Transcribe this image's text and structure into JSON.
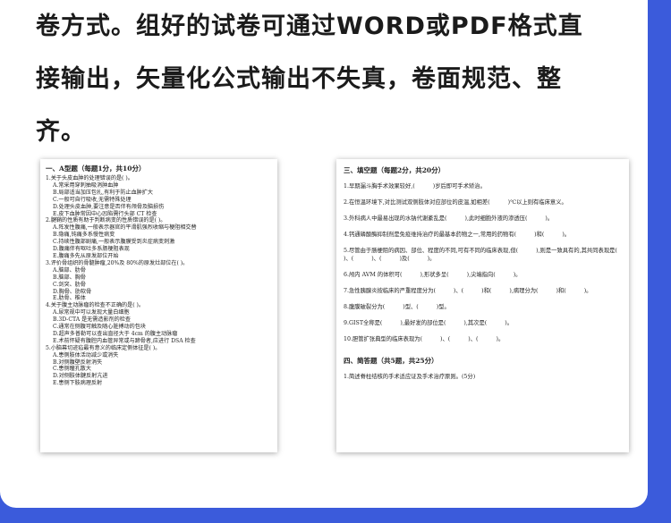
{
  "intro_lines": [
    "卷方式。组好的试卷可通过WORD或PDF格式直",
    "接输出，矢量化公式输出不失真，卷面规范、整",
    "齐。"
  ],
  "left_paper": {
    "title": "一、A型题（每题1分，共10分）",
    "questions": [
      {
        "q": "1.关于头皮血肿的处理错误的是(     )。",
        "options": [
          "A.常采用穿刺抽吸消肿血肿",
          "B.局部适当加压包扎,有利于防止血肿扩大",
          "C.一般可自行吸收,无需特殊处理",
          "D.处理头皮血肿,要注意是否伴有颅骨及脑损伤",
          "E.皮下血肿常因中心凹陷需行头部 CT 检查"
        ]
      },
      {
        "q": "2.腱鞘的性质有助于判断病变的性质错误的是(     )。",
        "options": [
          "A.阵发性腹痛,一般表示器官的平滑肌强烈收缩与梗阻相交替",
          "B.隐痛,钝痛多系慢性病变",
          "C.持续性腹部剧痛,一般表示腹膜受到炎症病变刺激",
          "D.腹痛伴有呕吐多系肠梗阻表现",
          "E.腹痛多先从原发部位开始"
        ]
      },
      {
        "q": "3.评价骨组织的骨髓肿瘤,20%及 80%的原发灶部位在(     )。",
        "options": [
          "A.脑部、肋骨",
          "B.脑部、胸骨",
          "C.剑突、肋骨",
          "D.胸骨、肋软骨",
          "E.肋骨、椎体"
        ]
      },
      {
        "q": "4.关于腹主动脉瘤的检查不正确的是(     )。",
        "options": [
          "A.尿常规中可以发现大量白细胞",
          "B.3D-CTA 是无需造影剂的检查",
          "C.通常在侧腹可触及随心脏搏动的包块",
          "D.超声多普勒可以查出直径大于 4cm 的腹主动脉瘤",
          "E.术前怀疑有腹腔内血管异常或与蹄骨者,应进行 DSA 检查"
        ]
      },
      {
        "q": "5.小脑幕切迹疝最有意义的临床定侧体征是(     )。",
        "options": [
          "A.患侧肢体活动减少或消失",
          "B.对侧腹壁反射消失",
          "C.患侧瞳孔散大",
          "D.对侧肢体腱反射亢进",
          "E.患侧下肢病理反射"
        ]
      }
    ]
  },
  "right_paper": {
    "title": "三、填空题（每题2分，共20分）",
    "items": [
      "1.早期漏斗胸手术效果较好,(          )岁后即可手术矫治。",
      "2.在恒温环境下,对比测试双侧肢体对应部位的皮温,如相差(          )℃以上则有临床意义。",
      "3.外科病人中最易出现的水钠代谢紊乱是(          ),此时细胞外液的渗透压(          )。",
      "4.钙通磷酸酶抑制剂是免疫维持治疗的最基本药物之一,常用的药物有(          )和(          )。",
      "5.尽管由于肠梗阻的病因、部位、程度的不同,可有不同的临床表现,但(          ),则是一致具有的,其共同表现是(          )、(          )、(          )及(          )。",
      "6.颅内 AVM 的体积可(          ),形状多呈(          ),尖端指向(          )。",
      "7.急性胰腺炎按临床的严重程度分为(          )、(          )和(          ),病理分为(          )和(          )。",
      "8.腹膜破裂分为(          )型、(          )型。",
      "9.GIST全称是(          ),最好发的部位是(          ),其次是(          )。",
      "10.胆管扩张典型的临床表现为(          )、(          )、(          )。"
    ],
    "section4_title": "四、简答题（共5题，共25分）",
    "section4_item": "1.简述脊柱结核的手术适应证及手术治疗原则。(5分)"
  }
}
